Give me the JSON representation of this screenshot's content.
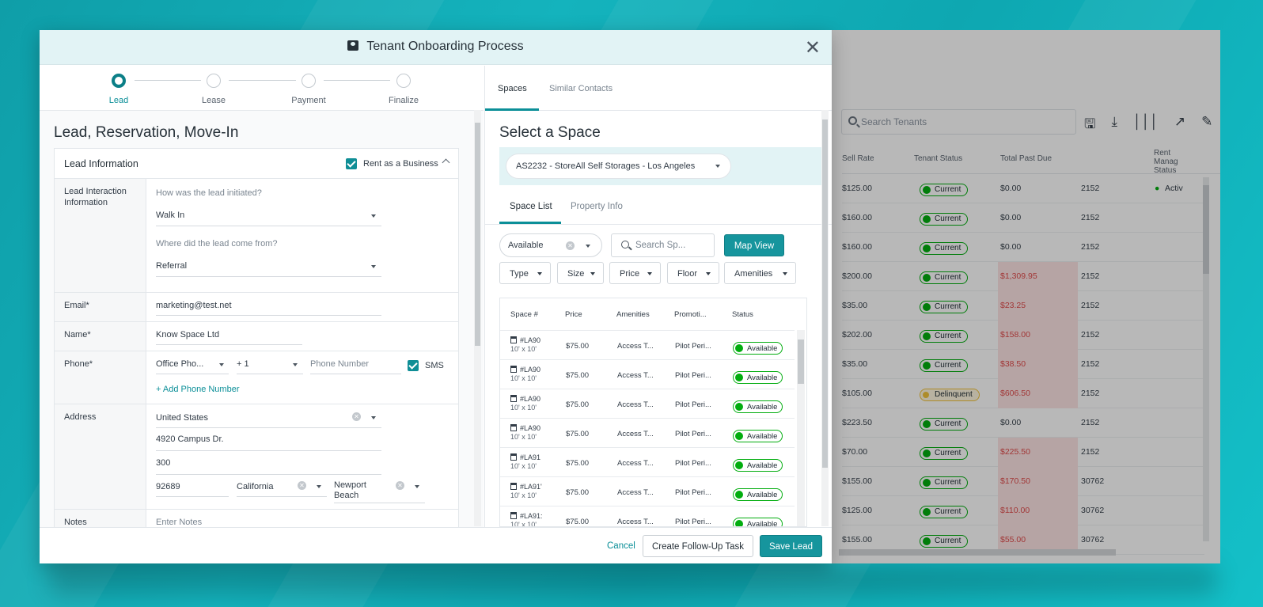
{
  "modal": {
    "title": "Tenant Onboarding Process"
  },
  "steps": [
    "Lead",
    "Lease",
    "Payment",
    "Finalize"
  ],
  "left": {
    "heading": "Lead, Reservation, Move-In",
    "card_title": "Lead Information",
    "rent_as_business": "Rent as a Business",
    "interaction_label": "Lead Interaction Information",
    "q1": "How was the lead initiated?",
    "q1_value": "Walk In",
    "q2": "Where did the lead come from?",
    "q2_value": "Referral",
    "email_label": "Email*",
    "email_value": "marketing@test.net",
    "name_label": "Name*",
    "name_value": "Know Space Ltd",
    "phone_label": "Phone*",
    "phone_type": "Office Pho...",
    "phone_code": "+ 1",
    "phone_placeholder": "Phone Number",
    "sms": "SMS",
    "add_phone": "+ Add Phone Number",
    "address_label": "Address",
    "country": "United States",
    "street": "4920 Campus Dr.",
    "unit": "300",
    "zip": "92689",
    "state": "California",
    "city": "Newport Beach",
    "notes_label": "Notes",
    "notes_placeholder": "Enter Notes"
  },
  "right": {
    "tabs": [
      "Spaces",
      "Similar Contacts"
    ],
    "heading": "Select a Space",
    "facility": "AS2232 - StoreAll Self Storages - Los Angeles",
    "subtabs": [
      "Space List",
      "Property Info"
    ],
    "status_filter": "Available",
    "search_placeholder": "Search Sp...",
    "map_view": "Map View",
    "filters": [
      "Type",
      "Size",
      "Price",
      "Floor",
      "Amenities"
    ],
    "columns": [
      "Space #",
      "Price",
      "Amenities",
      "Promoti...",
      "Status"
    ],
    "rows": [
      {
        "space": "#LA90",
        "size": "10' x 10'",
        "price": "$75.00",
        "amenities": "Access T...",
        "promo": "Pilot Peri...",
        "status": "Available"
      },
      {
        "space": "#LA90",
        "size": "10' x 10'",
        "price": "$75.00",
        "amenities": "Access T...",
        "promo": "Pilot Peri...",
        "status": "Available"
      },
      {
        "space": "#LA90",
        "size": "10' x 10'",
        "price": "$75.00",
        "amenities": "Access T...",
        "promo": "Pilot Peri...",
        "status": "Available"
      },
      {
        "space": "#LA90",
        "size": "10' x 10'",
        "price": "$75.00",
        "amenities": "Access T...",
        "promo": "Pilot Peri...",
        "status": "Available"
      },
      {
        "space": "#LA91",
        "size": "10' x 10'",
        "price": "$75.00",
        "amenities": "Access T...",
        "promo": "Pilot Peri...",
        "status": "Available"
      },
      {
        "space": "#LA91'",
        "size": "10' x 10'",
        "price": "$75.00",
        "amenities": "Access T...",
        "promo": "Pilot Peri...",
        "status": "Available"
      },
      {
        "space": "#LA91:",
        "size": "10' x 10'",
        "price": "$75.00",
        "amenities": "Access T...",
        "promo": "Pilot Peri...",
        "status": "Available"
      }
    ]
  },
  "footer": {
    "cancel": "Cancel",
    "followup": "Create Follow-Up Task",
    "save": "Save Lead"
  },
  "background": {
    "search_placeholder": "Search Tenants",
    "columns": [
      "Sell Rate",
      "Tenant Status",
      "Total Past Due",
      "Rent Manag Status"
    ],
    "active_label": "Activ",
    "rows": [
      {
        "rate": "$125.00",
        "status": "Current",
        "past_due": "$0.00",
        "code": "2152",
        "red": false
      },
      {
        "rate": "$160.00",
        "status": "Current",
        "past_due": "$0.00",
        "code": "2152",
        "red": false
      },
      {
        "rate": "$160.00",
        "status": "Current",
        "past_due": "$0.00",
        "code": "2152",
        "red": false
      },
      {
        "rate": "$200.00",
        "status": "Current",
        "past_due": "$1,309.95",
        "code": "2152",
        "red": true
      },
      {
        "rate": "$35.00",
        "status": "Current",
        "past_due": "$23.25",
        "code": "2152",
        "red": true
      },
      {
        "rate": "$202.00",
        "status": "Current",
        "past_due": "$158.00",
        "code": "2152",
        "red": true
      },
      {
        "rate": "$35.00",
        "status": "Current",
        "past_due": "$38.50",
        "code": "2152",
        "red": true
      },
      {
        "rate": "$105.00",
        "status": "Delinquent",
        "past_due": "$606.50",
        "code": "2152",
        "red": true
      },
      {
        "rate": "$223.50",
        "status": "Current",
        "past_due": "$0.00",
        "code": "2152",
        "red": false
      },
      {
        "rate": "$70.00",
        "status": "Current",
        "past_due": "$225.50",
        "code": "2152",
        "red": true
      },
      {
        "rate": "$155.00",
        "status": "Current",
        "past_due": "$170.50",
        "code": "30762",
        "red": true
      },
      {
        "rate": "$125.00",
        "status": "Current",
        "past_due": "$110.00",
        "code": "30762",
        "red": true
      },
      {
        "rate": "$155.00",
        "status": "Current",
        "past_due": "$55.00",
        "code": "30762",
        "red": true
      }
    ]
  },
  "colors": {
    "teal": "#16959d",
    "accent": "#0b8f98",
    "green": "#02ad0f",
    "red": "#e04b4b",
    "header": "#e2f3f5"
  }
}
